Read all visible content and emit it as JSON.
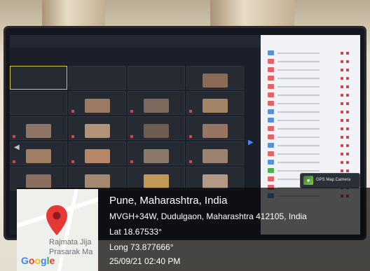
{
  "gps_app": {
    "label": "GPS Map Camera"
  },
  "map": {
    "place_line1": "Rajmata Jija",
    "place_line2": "Prasarak Ma",
    "google_letters": [
      "G",
      "o",
      "o",
      "g",
      "l",
      "e"
    ],
    "pin_color": "#e53935"
  },
  "location": {
    "city": "Pune, Maharashtra, India",
    "address": "MVGH+34W, Dudulgaon, Maharashtra 412105, India",
    "lat": "Lat 18.67533°",
    "long": "Long 73.877666°",
    "datetime": "25/09/21 02:40 PM"
  },
  "colors": {
    "overlay": "#0a0a0c",
    "accent_blue": "#3a8cff",
    "mic_red": "#d64545"
  }
}
